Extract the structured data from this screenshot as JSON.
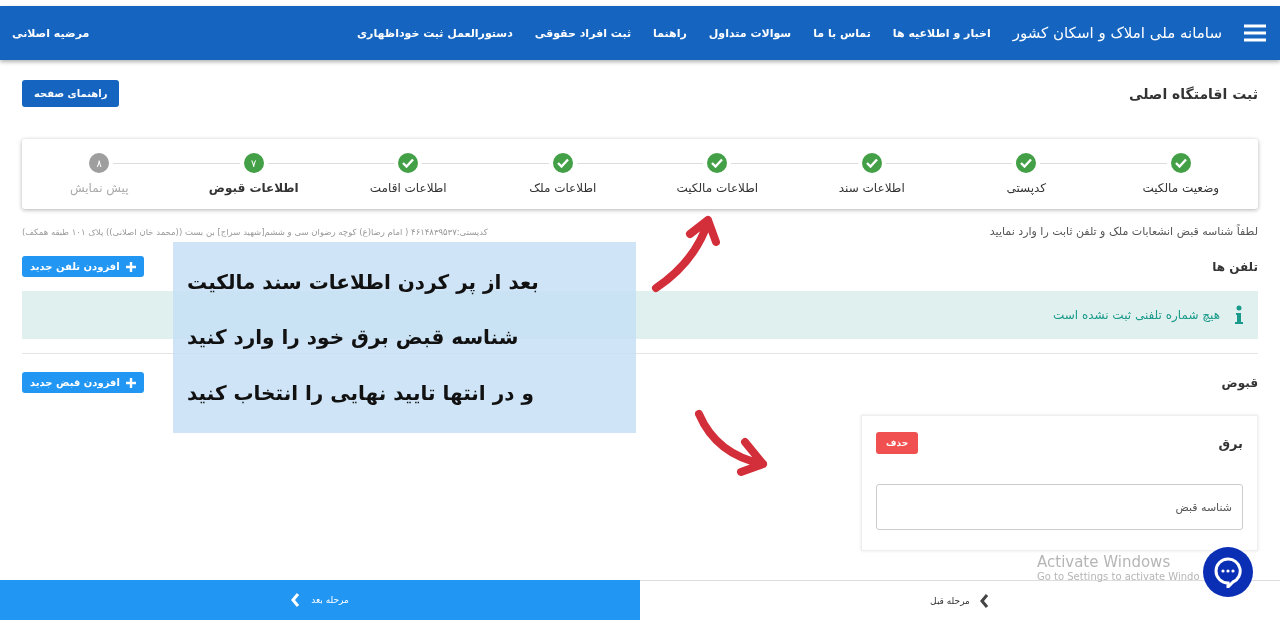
{
  "header": {
    "title": "سامانه ملی املاک و اسکان کشور",
    "nav": [
      "اخبار و اطلاعیه ها",
      "تماس با ما",
      "سوالات متداول",
      "راهنما",
      "ثبت افراد حقوقی",
      "دستورالعمل ثبت خوداظهاری"
    ],
    "user": "مرضیه اصلانی"
  },
  "page": {
    "title": "ثبت اقامتگاه اصلی",
    "help_button": "راهنمای صفحه"
  },
  "steps": [
    {
      "label": "وضعیت مالکیت",
      "completed": true,
      "selected": false
    },
    {
      "label": "کدپستی",
      "completed": true,
      "selected": false
    },
    {
      "label": "اطلاعات سند",
      "completed": true,
      "selected": false
    },
    {
      "label": "اطلاعات مالکیت",
      "completed": true,
      "selected": false
    },
    {
      "label": "اطلاعات ملک",
      "completed": true,
      "selected": false
    },
    {
      "label": "اطلاعات اقامت",
      "completed": true,
      "selected": false
    },
    {
      "label": "اطلاعات قبوض",
      "completed": false,
      "selected": true,
      "number": "۷"
    },
    {
      "label": "پیش نمایش",
      "completed": false,
      "selected": false,
      "number": "۸"
    }
  ],
  "instruction": "لطفاً شناسه قبض انشعابات ملک و تلفن ثابت را وارد نمایید",
  "address": "کدپستی:۴۶۱۴۸۳۹۵۳۷ ( امام رضا(ع) کوچه رضوان سی و ششم[شهید سراج] بن بست ((محمد خان اصلانی)) پلاک ۱۰۱ طبقه همکف)",
  "phones": {
    "title": "تلفن ها",
    "add_button": "افزودن تلفن جدید",
    "alert": "هیچ شماره تلفنی ثبت نشده است"
  },
  "bills": {
    "title": "قبوض",
    "add_button": "افزودن قبض جدید",
    "items": [
      {
        "title": "برق",
        "delete_button": "حذف",
        "placeholder": "شناسه قبض"
      }
    ]
  },
  "footer": {
    "next": "مرحله بعد",
    "prev": "مرحله قبل"
  },
  "annotation": {
    "lines": [
      "بعد از پر کردن اطلاعات سند مالکیت",
      "شناسه قبض برق خود را وارد کنید",
      "و در انتها تایید نهایی را انتخاب کنید"
    ]
  },
  "os_notice": {
    "title": "Activate Windows",
    "subtitle": "Go to Settings to activate Windo"
  }
}
